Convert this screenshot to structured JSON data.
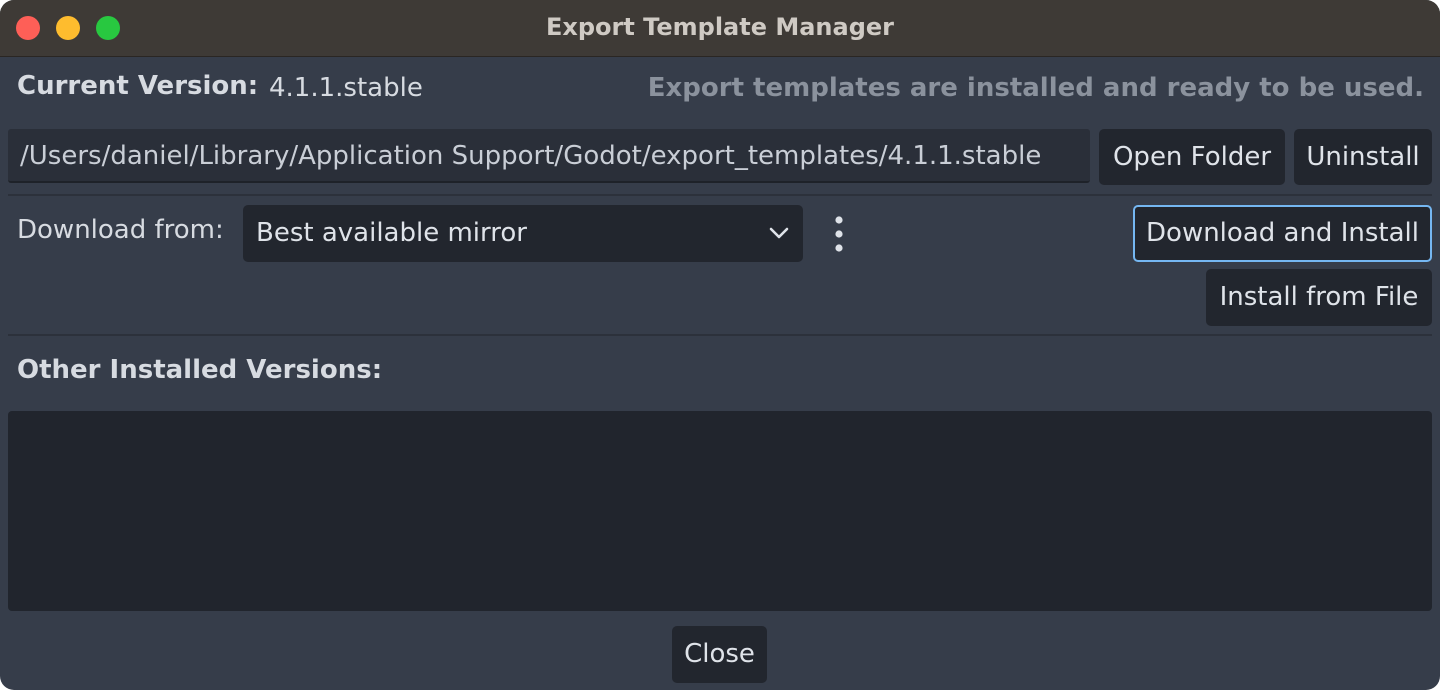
{
  "window": {
    "title": "Export Template Manager"
  },
  "current_version": {
    "label": "Current Version:",
    "value": "4.1.1.stable",
    "status_message": "Export templates are installed and ready to be used."
  },
  "path": {
    "value": "/Users/daniel/Library/Application Support/Godot/export_templates/4.1.1.stable",
    "open_folder_label": "Open Folder",
    "uninstall_label": "Uninstall"
  },
  "download": {
    "label": "Download from:",
    "selected_mirror": "Best available mirror",
    "download_install_label": "Download and Install",
    "install_from_file_label": "Install from File"
  },
  "other_versions": {
    "label": "Other Installed Versions:",
    "items": []
  },
  "footer": {
    "close_label": "Close"
  },
  "colors": {
    "background": "#363d4a",
    "titlebar": "#3e3a36",
    "button": "#22262e",
    "accent_focus": "#75b7f2",
    "traffic_close": "#fe5f57",
    "traffic_minimize": "#febc2e",
    "traffic_maximize": "#28c840"
  },
  "icons": {
    "dropdown": "chevron-down-icon",
    "more": "vertical-ellipsis-icon"
  }
}
